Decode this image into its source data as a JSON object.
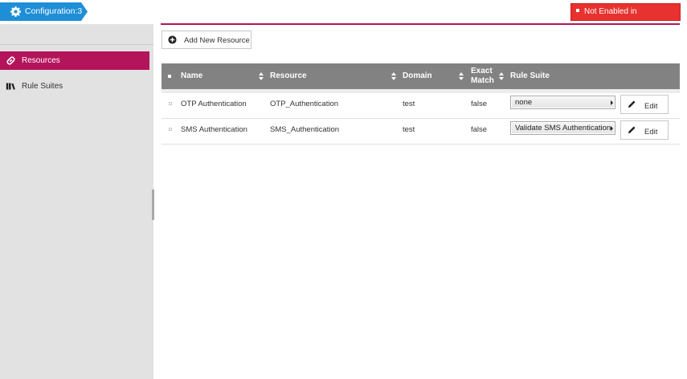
{
  "header": {
    "config_label": "Configuration:3",
    "alert_text": "Not Enabled in Configuration",
    "accent_color": "#1e8fd6",
    "alert_color": "#e8322f"
  },
  "sidebar": {
    "items": [
      {
        "label": "Resources",
        "icon": "link-icon",
        "active": true
      },
      {
        "label": "Rule Suites",
        "icon": "books-icon",
        "active": false
      }
    ],
    "active_color": "#b3145a"
  },
  "toolbar": {
    "add_label": "Add New Resource"
  },
  "table": {
    "columns": [
      "Name",
      "Resource",
      "Domain",
      "Exact Match",
      "Rule Suite"
    ],
    "exact_match_lines": [
      "Exact",
      "Match"
    ],
    "rows": [
      {
        "name": "OTP Authentication",
        "resource": "OTP_Authentication",
        "domain": "test",
        "exact_match": "false",
        "rule_suite": "none",
        "edit_label": "Edit"
      },
      {
        "name": "SMS Authentication",
        "resource": "SMS_Authentication",
        "domain": "test",
        "exact_match": "false",
        "rule_suite": "Validate SMS Authentication",
        "edit_label": "Edit"
      }
    ]
  }
}
